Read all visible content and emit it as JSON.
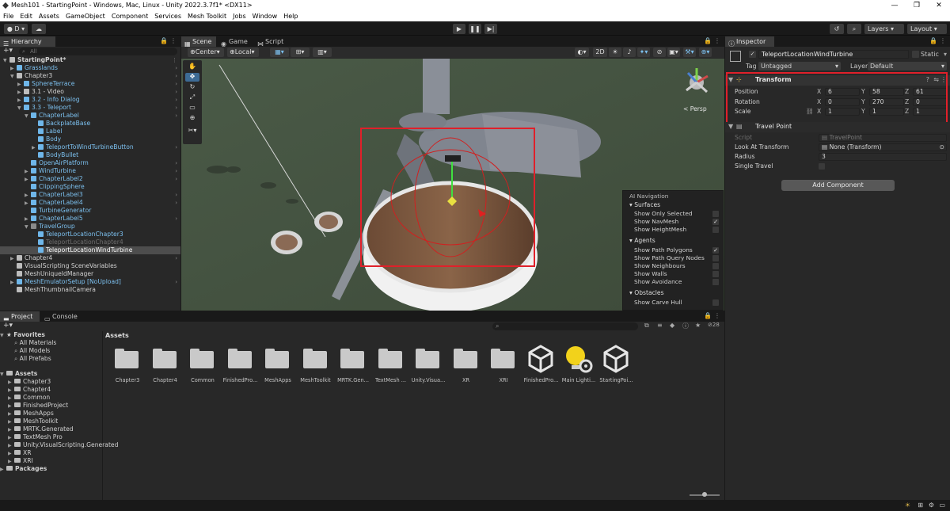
{
  "window": {
    "title": "Mesh101 - StartingPoint - Windows, Mac, Linux - Unity 2022.3.7f1* <DX11>",
    "controls": [
      "—",
      "❐",
      "✕"
    ]
  },
  "menu": [
    "File",
    "Edit",
    "Assets",
    "GameObject",
    "Component",
    "Services",
    "Mesh Toolkit",
    "Jobs",
    "Window",
    "Help"
  ],
  "toolbar": {
    "account": "D",
    "layers": "Layers",
    "layout": "Layout"
  },
  "hierarchy": {
    "tab": "Hierarchy",
    "search_placeholder": "All",
    "rows": [
      {
        "label": "StartingPoint*",
        "depth": 0,
        "expand": "▼",
        "icon": "unity",
        "style": "bold"
      },
      {
        "label": "Grasslands",
        "depth": 1,
        "expand": "▶",
        "icon": "blue",
        "style": "blue",
        "chev": true
      },
      {
        "label": "Chapter3",
        "depth": 1,
        "expand": "▼",
        "icon": "white",
        "style": "normal",
        "chev": true
      },
      {
        "label": "SphereTerrace",
        "depth": 2,
        "expand": "▶",
        "icon": "blue",
        "style": "blue",
        "chev": true
      },
      {
        "label": "3.1 - Video",
        "depth": 2,
        "expand": "▶",
        "icon": "white",
        "style": "normal",
        "chev": true
      },
      {
        "label": "3.2 - Info Dialog",
        "depth": 2,
        "expand": "▶",
        "icon": "blue",
        "style": "blue",
        "chev": true
      },
      {
        "label": "3.3 - Teleport",
        "depth": 2,
        "expand": "▼",
        "icon": "blue",
        "style": "blue",
        "chev": true
      },
      {
        "label": "ChapterLabel",
        "depth": 3,
        "expand": "▼",
        "icon": "blue",
        "style": "blue",
        "chev": true
      },
      {
        "label": "BackplateBase",
        "depth": 4,
        "expand": "",
        "icon": "blue",
        "style": "blue",
        "chev": false
      },
      {
        "label": "Label",
        "depth": 4,
        "expand": "",
        "icon": "blue",
        "style": "blue",
        "chev": false
      },
      {
        "label": "Body",
        "depth": 4,
        "expand": "",
        "icon": "blue",
        "style": "blue",
        "chev": false
      },
      {
        "label": "TeleportToWindTurbineButton",
        "depth": 4,
        "expand": "▶",
        "icon": "blue",
        "style": "blue",
        "chev": true
      },
      {
        "label": "BodyBullet",
        "depth": 4,
        "expand": "",
        "icon": "blue",
        "style": "blue",
        "chev": false
      },
      {
        "label": "OpenAirPlatform",
        "depth": 3,
        "expand": "",
        "icon": "blue",
        "style": "blue",
        "chev": true
      },
      {
        "label": "WindTurbine",
        "depth": 3,
        "expand": "▶",
        "icon": "blue",
        "style": "blue",
        "chev": true
      },
      {
        "label": "ChapterLabel2",
        "depth": 3,
        "expand": "▶",
        "icon": "blue",
        "style": "blue",
        "chev": true
      },
      {
        "label": "ClippingSphere",
        "depth": 3,
        "expand": "",
        "icon": "blue",
        "style": "blue",
        "chev": false
      },
      {
        "label": "ChapterLabel3",
        "depth": 3,
        "expand": "▶",
        "icon": "blue",
        "style": "blue",
        "chev": true
      },
      {
        "label": "ChapterLabel4",
        "depth": 3,
        "expand": "▶",
        "icon": "blue",
        "style": "blue",
        "chev": true
      },
      {
        "label": "TurbineGenerator",
        "depth": 3,
        "expand": "",
        "icon": "blue",
        "style": "blue",
        "chev": false
      },
      {
        "label": "ChapterLabel5",
        "depth": 3,
        "expand": "▶",
        "icon": "blue",
        "style": "blue",
        "chev": true
      },
      {
        "label": "TravelGroup",
        "depth": 3,
        "expand": "▼",
        "icon": "gray",
        "style": "blue",
        "chev": false
      },
      {
        "label": "TeleportLocationChapter3",
        "depth": 4,
        "expand": "",
        "icon": "blue",
        "style": "blue",
        "chev": false
      },
      {
        "label": "TeleportLocationChapter4",
        "depth": 4,
        "expand": "",
        "icon": "blue",
        "style": "dim",
        "chev": false
      },
      {
        "label": "TeleportLocationWindTurbine",
        "depth": 4,
        "expand": "",
        "icon": "blue",
        "style": "selected",
        "chev": false
      },
      {
        "label": "Chapter4",
        "depth": 1,
        "expand": "▶",
        "icon": "white",
        "style": "normal",
        "chev": true
      },
      {
        "label": "VisualScripting SceneVariables",
        "depth": 1,
        "expand": "",
        "icon": "white",
        "style": "normal",
        "chev": false
      },
      {
        "label": "MeshUniqueIdManager",
        "depth": 1,
        "expand": "",
        "icon": "white",
        "style": "normal",
        "chev": false
      },
      {
        "label": "MeshEmulatorSetup [NoUpload]",
        "depth": 1,
        "expand": "▶",
        "icon": "blue",
        "style": "blue",
        "chev": true
      },
      {
        "label": "MeshThumbnailCamera",
        "depth": 1,
        "expand": "",
        "icon": "white",
        "style": "normal",
        "chev": false
      }
    ]
  },
  "scene": {
    "tabs": [
      "Scene",
      "Game",
      "Script Graph"
    ],
    "pivot": "Center",
    "space": "Local",
    "mode2d": "2D",
    "persp": "< Persp",
    "ai_nav": {
      "title": "AI Navigation",
      "sections": [
        {
          "name": "Surfaces",
          "items": [
            {
              "label": "Show Only Selected",
              "checked": false
            },
            {
              "label": "Show NavMesh",
              "checked": true
            },
            {
              "label": "Show HeightMesh",
              "checked": false
            }
          ]
        },
        {
          "name": "Agents",
          "items": [
            {
              "label": "Show Path Polygons",
              "checked": true
            },
            {
              "label": "Show Path Query Nodes",
              "checked": false
            },
            {
              "label": "Show Neighbours",
              "checked": false
            },
            {
              "label": "Show Walls",
              "checked": false
            },
            {
              "label": "Show Avoidance",
              "checked": false
            }
          ]
        },
        {
          "name": "Obstacles",
          "items": [
            {
              "label": "Show Carve Hull",
              "checked": false
            }
          ]
        }
      ]
    }
  },
  "inspector": {
    "tab": "Inspector",
    "object_name": "TeleportLocationWindTurbine",
    "static_label": "Static",
    "tag_label": "Tag",
    "tag_value": "Untagged",
    "layer_label": "Layer",
    "layer_value": "Default",
    "transform": {
      "title": "Transform",
      "rows": [
        {
          "label": "Position",
          "x": "6",
          "y": "58",
          "z": "61"
        },
        {
          "label": "Rotation",
          "x": "0",
          "y": "270",
          "z": "0"
        },
        {
          "label": "Scale",
          "x": "1",
          "y": "1",
          "z": "1"
        }
      ]
    },
    "travel_point": {
      "title": "Travel Point",
      "script_label": "Script",
      "script_value": "TravelPoint",
      "look_label": "Look At Transform",
      "look_value": "None (Transform)",
      "radius_label": "Radius",
      "radius_value": "3",
      "single_label": "Single Travel"
    },
    "add_component": "Add Component"
  },
  "project": {
    "tabs": [
      "Project",
      "Console"
    ],
    "hidden_count": "28",
    "favorites": {
      "title": "Favorites",
      "items": [
        "All Materials",
        "All Models",
        "All Prefabs"
      ]
    },
    "assets_tree": {
      "title": "Assets",
      "items": [
        "Chapter3",
        "Chapter4",
        "Common",
        "FinishedProject",
        "MeshApps",
        "MeshToolkit",
        "MRTK.Generated",
        "TextMesh Pro",
        "Unity.VisualScripting.Generated",
        "XR",
        "XRI"
      ]
    },
    "packages": "Packages",
    "breadcrumb": "Assets",
    "grid": [
      {
        "label": "Chapter3",
        "kind": "folder"
      },
      {
        "label": "Chapter4",
        "kind": "folder"
      },
      {
        "label": "Common",
        "kind": "folder"
      },
      {
        "label": "FinishedPro...",
        "kind": "folder"
      },
      {
        "label": "MeshApps",
        "kind": "folder"
      },
      {
        "label": "MeshToolkit",
        "kind": "folder"
      },
      {
        "label": "MRTK.Gen...",
        "kind": "folder"
      },
      {
        "label": "TextMesh ...",
        "kind": "folder"
      },
      {
        "label": "Unity.Visua...",
        "kind": "folder"
      },
      {
        "label": "XR",
        "kind": "folder"
      },
      {
        "label": "XRI",
        "kind": "folder"
      },
      {
        "label": "FinishedPro...",
        "kind": "unity"
      },
      {
        "label": "Main Lighti...",
        "kind": "lighting"
      },
      {
        "label": "StartingPoi...",
        "kind": "unity"
      }
    ]
  },
  "colors": {
    "selection": "#e0202a",
    "accent": "#7cc0ef",
    "panel": "#282828",
    "background": "#191919"
  }
}
